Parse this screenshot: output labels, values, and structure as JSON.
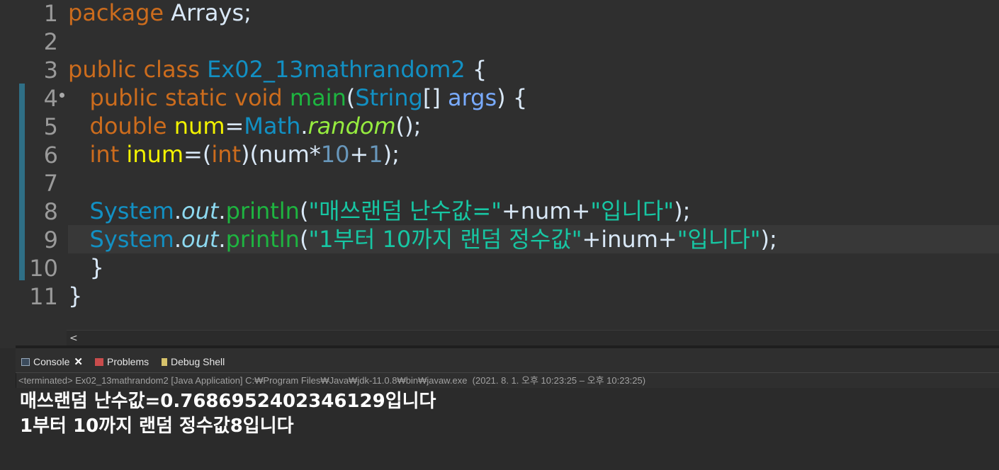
{
  "editor": {
    "line_numbers": [
      "1",
      "2",
      "3",
      "4",
      "5",
      "6",
      "7",
      "8",
      "9",
      "10",
      "11"
    ],
    "lines": [
      {
        "tokens": [
          {
            "c": "kw",
            "t": "package "
          },
          {
            "c": "plain",
            "t": "Arrays;"
          }
        ]
      },
      {
        "tokens": []
      },
      {
        "tokens": [
          {
            "c": "kw",
            "t": "public class "
          },
          {
            "c": "cls",
            "t": "Ex02_13mathrandom2"
          },
          {
            "c": "plain",
            "t": " {"
          }
        ]
      },
      {
        "tokens": [
          {
            "c": "plain",
            "t": "   "
          },
          {
            "c": "kw",
            "t": "public static void "
          },
          {
            "c": "method",
            "t": "main"
          },
          {
            "c": "plain",
            "t": "("
          },
          {
            "c": "cls",
            "t": "String"
          },
          {
            "c": "plain",
            "t": "[] "
          },
          {
            "c": "param",
            "t": "args"
          },
          {
            "c": "plain",
            "t": ") {"
          }
        ]
      },
      {
        "tokens": [
          {
            "c": "plain",
            "t": "   "
          },
          {
            "c": "kw",
            "t": "double "
          },
          {
            "c": "var",
            "t": "num"
          },
          {
            "c": "plain",
            "t": "="
          },
          {
            "c": "cls",
            "t": "Math"
          },
          {
            "c": "plain",
            "t": "."
          },
          {
            "c": "smethod",
            "t": "random"
          },
          {
            "c": "plain",
            "t": "();"
          }
        ]
      },
      {
        "tokens": [
          {
            "c": "plain",
            "t": "   "
          },
          {
            "c": "kw",
            "t": "int "
          },
          {
            "c": "var",
            "t": "inum"
          },
          {
            "c": "plain",
            "t": "=("
          },
          {
            "c": "kw",
            "t": "int"
          },
          {
            "c": "plain",
            "t": ")("
          },
          {
            "c": "plain",
            "t": "num*"
          },
          {
            "c": "num",
            "t": "10"
          },
          {
            "c": "plain",
            "t": "+"
          },
          {
            "c": "num",
            "t": "1"
          },
          {
            "c": "plain",
            "t": ");"
          }
        ]
      },
      {
        "tokens": []
      },
      {
        "tokens": [
          {
            "c": "plain",
            "t": "   "
          },
          {
            "c": "cls",
            "t": "System"
          },
          {
            "c": "plain",
            "t": "."
          },
          {
            "c": "field",
            "t": "out"
          },
          {
            "c": "plain",
            "t": "."
          },
          {
            "c": "method",
            "t": "println"
          },
          {
            "c": "plain",
            "t": "("
          },
          {
            "c": "str",
            "t": "\"매쓰랜덤 난수값=\""
          },
          {
            "c": "plain",
            "t": "+num+"
          },
          {
            "c": "str",
            "t": "\"입니다\""
          },
          {
            "c": "plain",
            "t": ");"
          }
        ]
      },
      {
        "tokens": [
          {
            "c": "plain",
            "t": "   "
          },
          {
            "c": "cls",
            "t": "System"
          },
          {
            "c": "plain",
            "t": "."
          },
          {
            "c": "field",
            "t": "out"
          },
          {
            "c": "plain",
            "t": "."
          },
          {
            "c": "method",
            "t": "println"
          },
          {
            "c": "plain",
            "t": "("
          },
          {
            "c": "str",
            "t": "\"1부터 10까지 랜덤 정수값\""
          },
          {
            "c": "plain",
            "t": "+inum+"
          },
          {
            "c": "str",
            "t": "\"입니다\""
          },
          {
            "c": "plain",
            "t": ");"
          }
        ]
      },
      {
        "tokens": [
          {
            "c": "plain",
            "t": "   }"
          }
        ]
      },
      {
        "tokens": [
          {
            "c": "plain",
            "t": "}"
          }
        ]
      }
    ],
    "scroll_left_glyph": "<"
  },
  "tabs": [
    {
      "label": "Console",
      "icon": "console-icon",
      "active": true,
      "close": "✕"
    },
    {
      "label": "Problems",
      "icon": "problems-icon",
      "active": false
    },
    {
      "label": "Debug Shell",
      "icon": "debug-shell-icon",
      "active": false
    }
  ],
  "console": {
    "status": "<terminated> Ex02_13mathrandom2 [Java Application] C:₩Program Files₩Java₩jdk-11.0.8₩bin₩javaw.exe  (2021. 8. 1. 오후 10:23:25 – 오후 10:23:25)",
    "output": [
      "매쓰랜덤 난수값=0.7686952402346129입니다",
      "1부터 10까지 랜덤 정수값8입니다"
    ]
  },
  "colors": {
    "keyword": "#cc6c1d",
    "class": "#1290c3",
    "method": "#1eb540",
    "string": "#17c6a3",
    "variable": "#f2f200",
    "number": "#6897bb",
    "background": "#2f2f2f"
  }
}
